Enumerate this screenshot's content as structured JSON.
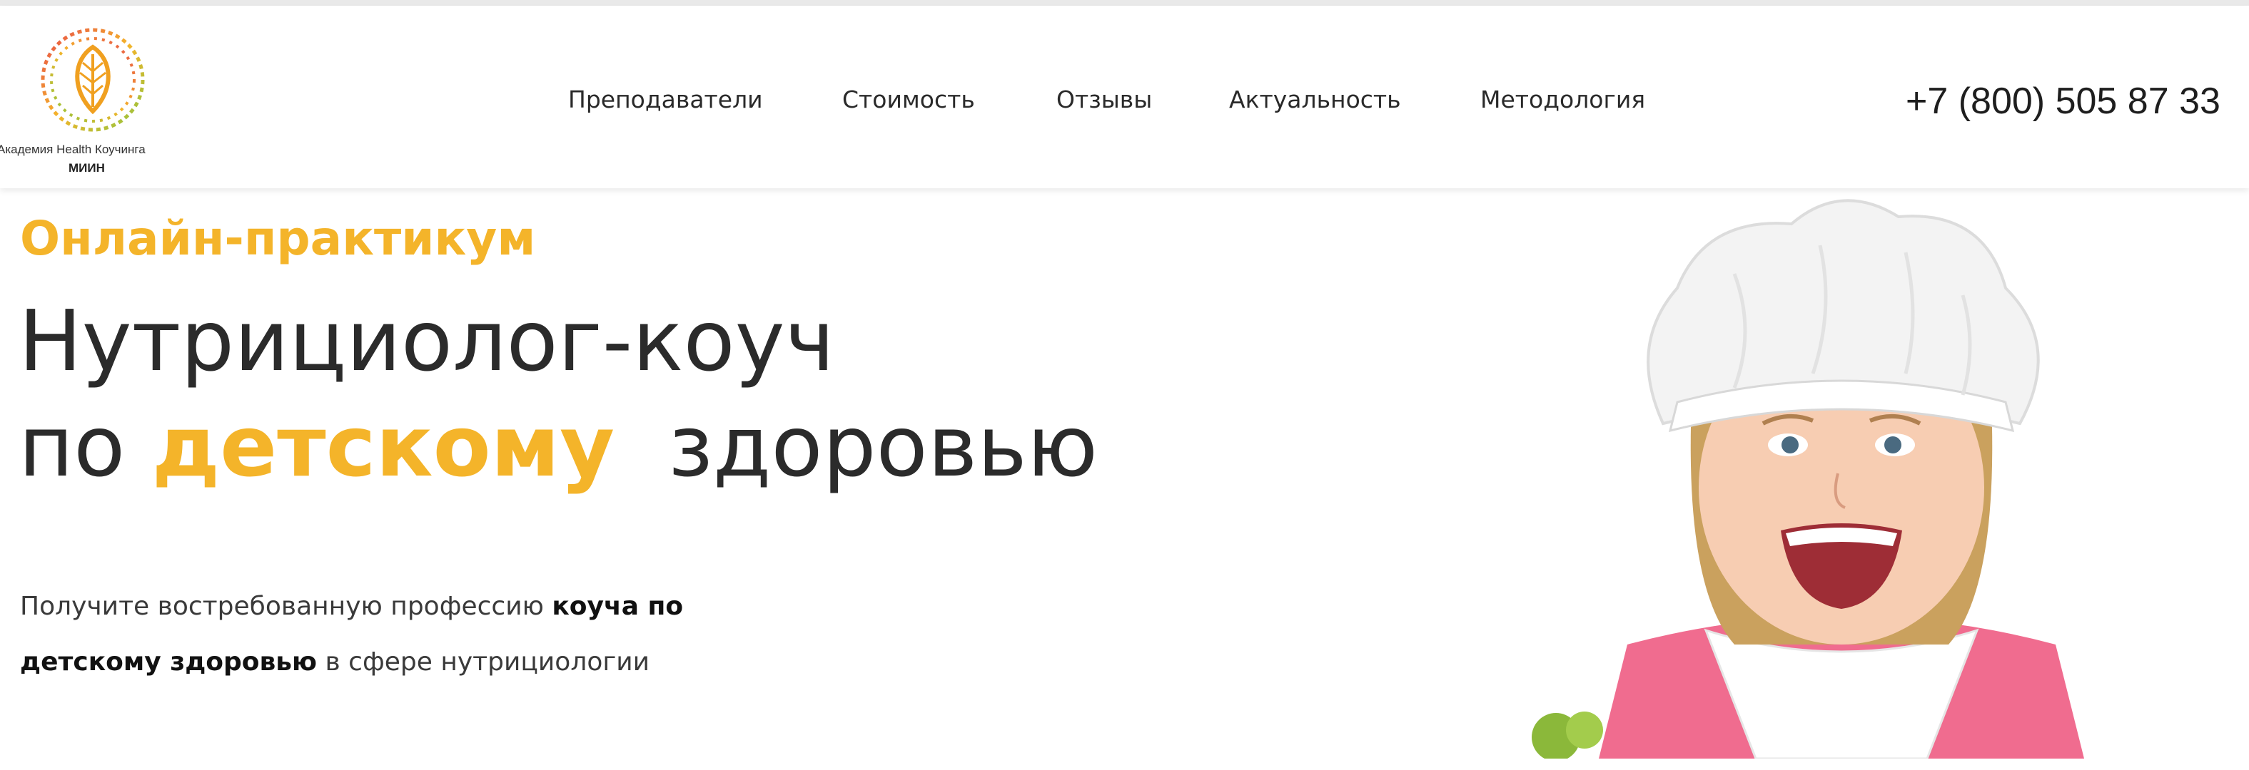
{
  "logo": {
    "caption": "Академия Health Коучинга",
    "brand": "МИИН"
  },
  "nav": {
    "items": [
      {
        "label": "Преподаватели"
      },
      {
        "label": "Стоимость"
      },
      {
        "label": "Отзывы"
      },
      {
        "label": "Актуальность"
      },
      {
        "label": "Методология"
      }
    ]
  },
  "phone": "+7 (800) 505 87 33",
  "hero": {
    "eyebrow": "Онлайн-практикум",
    "headline_line1": "Нутрициолог-коуч",
    "headline_line2_prefix": "по",
    "headline_line2_accent": "детскому",
    "headline_line2_suffix": "здоровью",
    "sub_part1": "Получите востребованную профессию",
    "sub_bold1": "коуча по",
    "sub_bold2": "детскому здоровью",
    "sub_part2": "в сфере нутрициологии"
  },
  "colors": {
    "accent": "#f4b42a",
    "text": "#2b2b2b"
  },
  "icons": {
    "logo": "leaf-dna-logo-icon"
  }
}
